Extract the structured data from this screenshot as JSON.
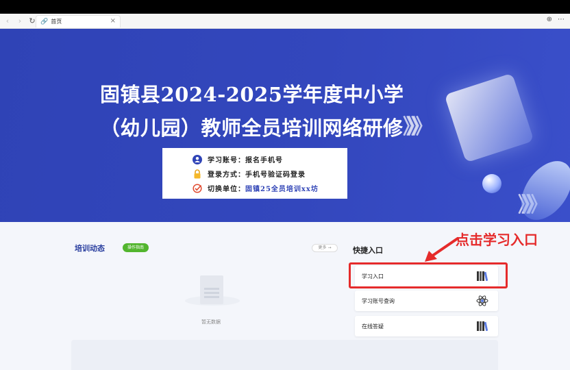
{
  "browser": {
    "tab_title": "首页",
    "tab_close": "×",
    "icons": [
      "back-icon",
      "forward-icon",
      "reload-icon",
      "link-icon",
      "extension-icon",
      "more-icon"
    ]
  },
  "banner": {
    "title_line1": "固镇县2024-2025学年度中小学",
    "title_line2": "（幼儿园）教师全员培训网络研修",
    "chevrons": "》》》",
    "info": {
      "account_label": "学习账号：",
      "account_value": "报名手机号",
      "login_label": "登录方式：",
      "login_value": "手机号验证码登录",
      "switch_label": "切换单位：",
      "switch_value": "固镇25全员培训xx坊"
    }
  },
  "news": {
    "title": "培训动态",
    "guide_button": "操作指南",
    "more_button": "更多 →",
    "empty_text": "暂无数据"
  },
  "quick": {
    "title": "快捷入口",
    "items": [
      {
        "label": "学习入口",
        "icon": "books-icon"
      },
      {
        "label": "学习账号查询",
        "icon": "atom-icon"
      },
      {
        "label": "在线答疑",
        "icon": "books-icon"
      }
    ]
  },
  "annotation": {
    "text": "点击学习入口",
    "color": "#e52b2b"
  },
  "colors": {
    "banner": "#3347bd",
    "accent": "#2a3f9f",
    "guide_green": "#52b52e"
  }
}
